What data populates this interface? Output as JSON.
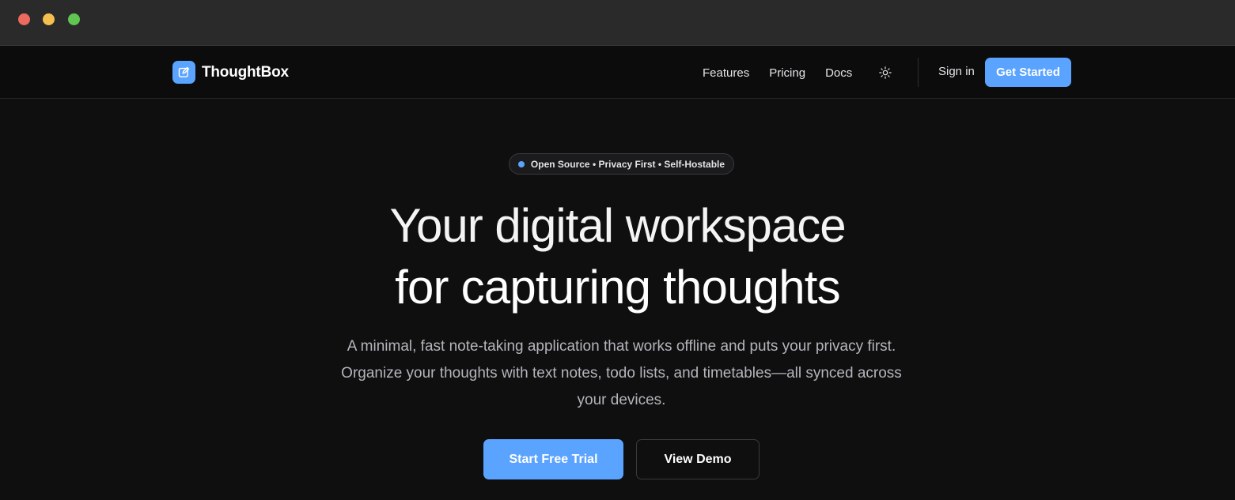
{
  "window": {
    "controls": [
      "close",
      "minimize",
      "maximize"
    ]
  },
  "nav": {
    "brand_name": "ThoughtBox",
    "brand_icon": "edit-note-icon",
    "links": [
      "Features",
      "Pricing",
      "Docs"
    ],
    "theme_icon": "sun-icon",
    "signin_label": "Sign in",
    "cta_label": "Get Started"
  },
  "hero": {
    "badge": "Open Source • Privacy First • Self-Hostable",
    "headline_line1": "Your digital workspace",
    "headline_line2": "for capturing thoughts",
    "subtitle": "A minimal, fast note-taking application that works offline and puts your privacy first. Organize your thoughts with text notes, todo lists, and timetables—all synced across your devices.",
    "primary_cta": "Start Free Trial",
    "secondary_cta": "View Demo"
  },
  "colors": {
    "accent": "#5aa3ff",
    "background": "#0f0f10",
    "chrome": "#2a2a2a",
    "traffic_red": "#ec6a5e",
    "traffic_yellow": "#f4bf4f",
    "traffic_green": "#61c554"
  }
}
